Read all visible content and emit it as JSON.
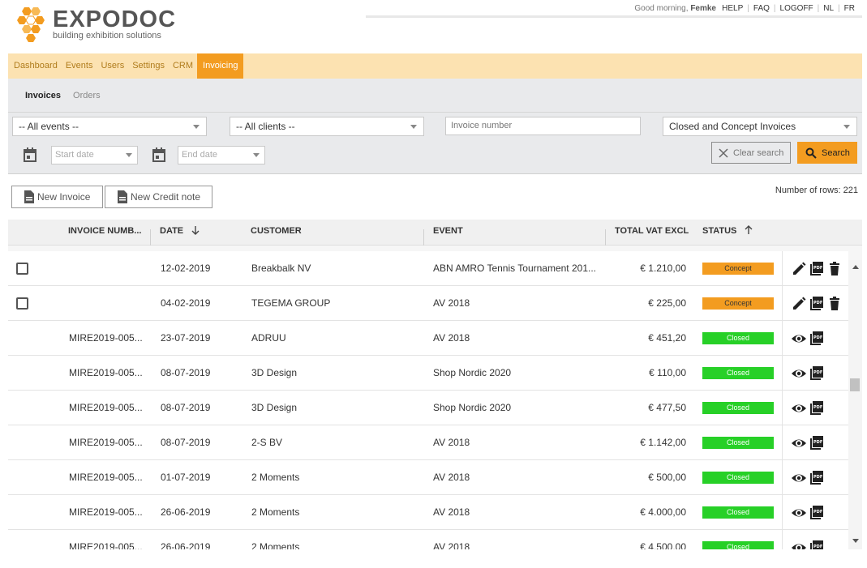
{
  "brand": {
    "name": "EXPODOC",
    "tagline": "building exhibition solutions",
    "color": "#f39c20"
  },
  "header": {
    "greeting_prefix": "Good morning,",
    "user_name": "Femke",
    "links": [
      "HELP",
      "FAQ",
      "LOGOFF",
      "NL",
      "FR"
    ]
  },
  "nav": {
    "items": [
      "Dashboard",
      "Events",
      "Users",
      "Settings",
      "CRM",
      "Invoicing"
    ],
    "active": "Invoicing"
  },
  "subnav": {
    "items": [
      "Invoices",
      "Orders"
    ],
    "active": "Invoices"
  },
  "filters": {
    "events_select": "-- All events --",
    "clients_select": "-- All clients --",
    "invoice_number_placeholder": "Invoice number",
    "status_select": "Closed and Concept Invoices",
    "start_date_placeholder": "Start date",
    "end_date_placeholder": "End date",
    "clear_label": "Clear search",
    "search_label": "Search"
  },
  "actions": {
    "new_invoice": "New Invoice",
    "new_credit_note": "New Credit note",
    "row_count": "Number of rows: 221"
  },
  "table": {
    "columns": [
      "INVOICE NUMB...",
      "DATE",
      "CUSTOMER",
      "EVENT",
      "TOTAL VAT EXCL",
      "STATUS"
    ],
    "rows": [
      {
        "checkbox": true,
        "number": "",
        "date": "12-02-2019",
        "customer": "Breakbalk NV",
        "event": "ABN AMRO Tennis Tournament 201...",
        "total": "€ 1.210,00",
        "status": "Concept"
      },
      {
        "checkbox": true,
        "number": "",
        "date": "04-02-2019",
        "customer": "TEGEMA GROUP",
        "event": "AV 2018",
        "total": "€ 225,00",
        "status": "Concept"
      },
      {
        "checkbox": false,
        "number": "MIRE2019-005...",
        "date": "23-07-2019",
        "customer": "ADRUU",
        "event": "AV 2018",
        "total": "€ 451,20",
        "status": "Closed"
      },
      {
        "checkbox": false,
        "number": "MIRE2019-005...",
        "date": "08-07-2019",
        "customer": "3D Design",
        "event": "Shop Nordic 2020",
        "total": "€ 110,00",
        "status": "Closed"
      },
      {
        "checkbox": false,
        "number": "MIRE2019-005...",
        "date": "08-07-2019",
        "customer": "3D Design",
        "event": "Shop Nordic 2020",
        "total": "€ 477,50",
        "status": "Closed"
      },
      {
        "checkbox": false,
        "number": "MIRE2019-005...",
        "date": "08-07-2019",
        "customer": "2-S BV",
        "event": "AV 2018",
        "total": "€ 1.142,00",
        "status": "Closed"
      },
      {
        "checkbox": false,
        "number": "MIRE2019-005...",
        "date": "01-07-2019",
        "customer": "2 Moments",
        "event": "AV 2018",
        "total": "€ 500,00",
        "status": "Closed"
      },
      {
        "checkbox": false,
        "number": "MIRE2019-005...",
        "date": "26-06-2019",
        "customer": "2 Moments",
        "event": "AV 2018",
        "total": "€ 4.000,00",
        "status": "Closed"
      },
      {
        "checkbox": false,
        "number": "MIRE2019-005...",
        "date": "26-06-2019",
        "customer": "2 Moments",
        "event": "AV 2018",
        "total": "€ 4.500,00",
        "status": "Closed"
      }
    ]
  },
  "colors": {
    "concept": "#f39c20",
    "closed": "#27d027",
    "nav_bg": "#fce2b1"
  }
}
